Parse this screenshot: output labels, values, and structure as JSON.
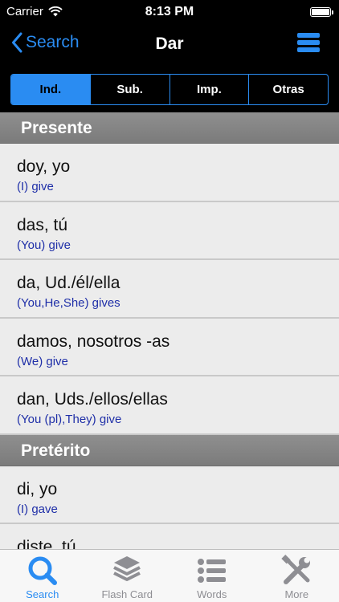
{
  "status": {
    "carrier": "Carrier",
    "time": "8:13 PM",
    "battery_level": 1.0
  },
  "nav": {
    "back_label": "Search",
    "title": "Dar"
  },
  "segments": [
    {
      "label": "Ind.",
      "active": true
    },
    {
      "label": "Sub.",
      "active": false
    },
    {
      "label": "Imp.",
      "active": false
    },
    {
      "label": "Otras",
      "active": false
    }
  ],
  "sections": [
    {
      "title": "Presente",
      "rows": [
        {
          "form": "doy, yo",
          "translation": "(I) give"
        },
        {
          "form": "das, tú",
          "translation": "(You) give"
        },
        {
          "form": "da, Ud./él/ella",
          "translation": "(You,He,She) gives"
        },
        {
          "form": "damos, nosotros -as",
          "translation": "(We) give"
        },
        {
          "form": "dan, Uds./ellos/ellas",
          "translation": "(You (pl),They) give"
        }
      ]
    },
    {
      "title": "Pretérito",
      "rows": [
        {
          "form": "di, yo",
          "translation": "(I) gave"
        },
        {
          "form": "diste, tú",
          "translation": ""
        }
      ]
    }
  ],
  "tabs": [
    {
      "label": "Search",
      "icon": "search-icon",
      "active": true
    },
    {
      "label": "Flash Card",
      "icon": "layers-icon",
      "active": false
    },
    {
      "label": "Words",
      "icon": "list-icon",
      "active": false
    },
    {
      "label": "More",
      "icon": "tools-icon",
      "active": false
    }
  ],
  "colors": {
    "accent": "#2a8cf2",
    "translation": "#1f2fa8",
    "section_bg": "#858585",
    "bar_bg": "#000000"
  }
}
